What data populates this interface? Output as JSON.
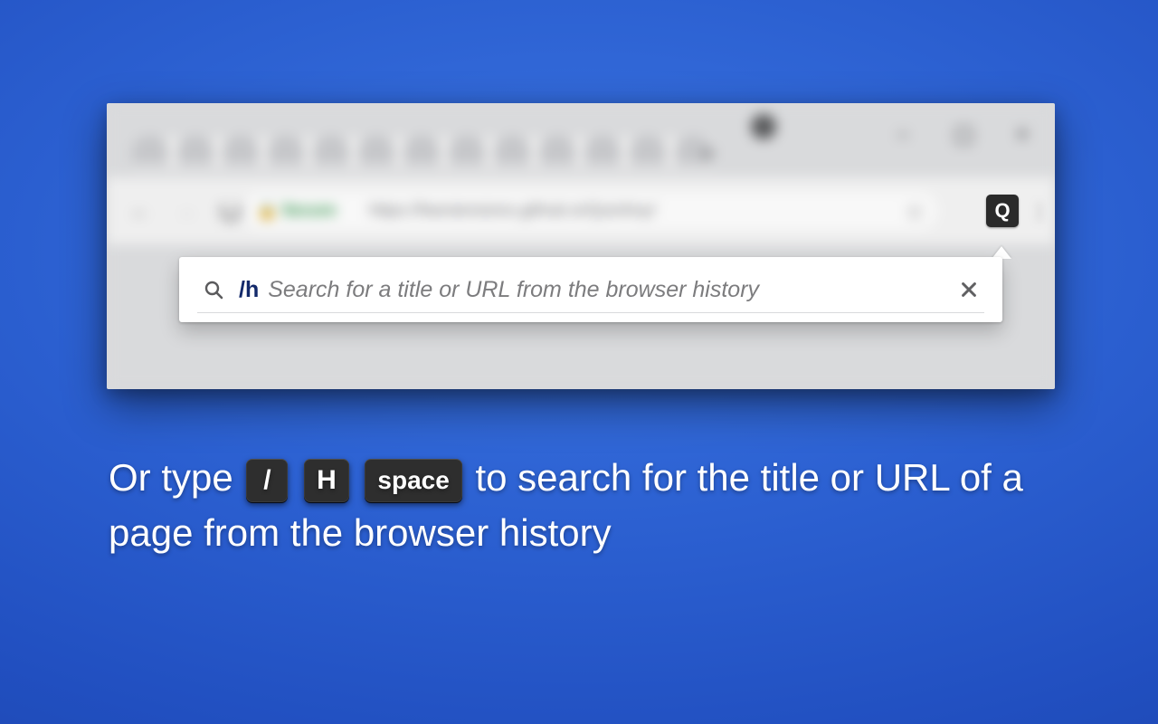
{
  "browser": {
    "security_label": "Secure",
    "url_display": "https://fwextensions.github.io/QuicKey/",
    "extension_letter": "Q"
  },
  "popup": {
    "prefix": "/h",
    "placeholder": "Search for a title or URL from the browser history"
  },
  "caption": {
    "before_keys": "Or type ",
    "key1": "/",
    "key2": "H",
    "key3": "space",
    "after_keys": " to search for the title or URL of a page from the browser history"
  }
}
